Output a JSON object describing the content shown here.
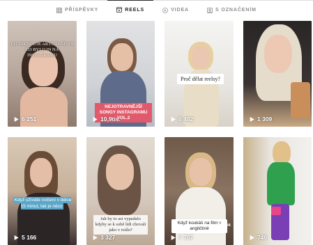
{
  "tabs": [
    {
      "label": "PŘÍSPĚVKY",
      "icon": "grid-icon"
    },
    {
      "label": "REELS",
      "icon": "reels-icon",
      "active": true
    },
    {
      "label": "VIDEA",
      "icon": "video-icon"
    },
    {
      "label": "S OZNAČENÍM",
      "icon": "tag-icon"
    }
  ],
  "reels": [
    {
      "views": "6 251",
      "caption": "CO TRENDUJE AKTUÁLNĚ VS CO BYLO IN NA INSTAGRAMU"
    },
    {
      "views": "10,9tis.",
      "caption": "NEJOTRAVNĚJŠÍ SONGY INSTAGRAMU VOL.2"
    },
    {
      "views": "6 482",
      "caption": "Proč dělat reelsy?"
    },
    {
      "views": "1 309",
      "caption": ""
    },
    {
      "views": "5 166",
      "caption": "Když užíváte cvičení v délce 15 minut, tak je něco"
    },
    {
      "views": "3 327",
      "caption": "Jak by to asi vypadalo kdyby se k sobě lidi chovali jako v reálu?"
    },
    {
      "views": "7 757",
      "caption": "Když koukáš na film v angličtině",
      "tiktok": "TikTok"
    },
    {
      "views": "746",
      "caption": ""
    }
  ]
}
